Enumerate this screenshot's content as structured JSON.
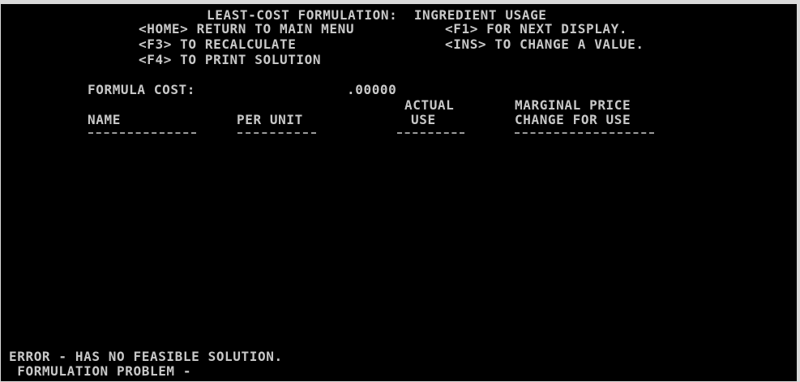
{
  "header": {
    "title": "LEAST-COST FORMULATION:  INGREDIENT USAGE",
    "home_key": "<HOME> RETURN TO MAIN MENU",
    "f1_key": "<F1> FOR NEXT DISPLAY.",
    "f3_key": "<F3> TO RECALCULATE",
    "ins_key": "<INS> TO CHANGE A VALUE.",
    "f4_key": "<F4> TO PRINT SOLUTION"
  },
  "formula": {
    "label": "FORMULA COST:",
    "value": ".00000"
  },
  "table": {
    "col_name": "NAME",
    "col_per_unit": "PER UNIT",
    "col_actual_top": "ACTUAL",
    "col_actual_bottom": "USE",
    "col_marginal_top": "MARGINAL PRICE",
    "col_marginal_bottom": "CHANGE FOR USE",
    "rows": []
  },
  "status": {
    "error": "ERROR - HAS NO FEASIBLE SOLUTION.",
    "problem": " FORMULATION PROBLEM -"
  },
  "colors": {
    "background": "#000000",
    "text": "#c8c8c8",
    "window_border": "#d9d9d9"
  }
}
